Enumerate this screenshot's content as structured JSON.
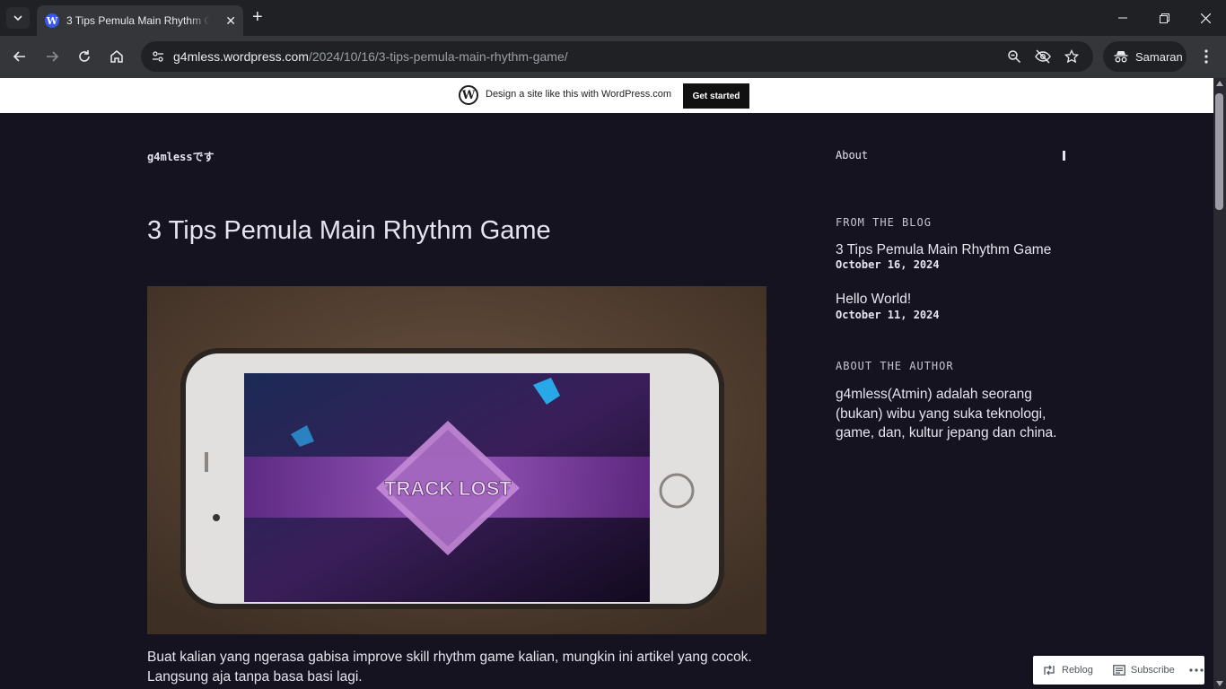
{
  "browser": {
    "tab_title": "3 Tips Pemula Main Rhythm Game",
    "url_host": "g4mless.wordpress.com",
    "url_path": "/2024/10/16/3-tips-pemula-main-rhythm-game/",
    "profile_label": "Samaran"
  },
  "wp_banner": {
    "text": "Design a site like this with WordPress.com",
    "button": "Get started"
  },
  "site": {
    "title": "g4mlessです",
    "nav_about": "About"
  },
  "post": {
    "title": "3 Tips Pemula Main Rhythm Game",
    "image_caption_text": "TRACK LOST",
    "excerpt": "Buat kalian yang ngerasa gabisa improve skill rhythm game kalian, mungkin ini artikel yang cocok. Langsung aja tanpa basa basi lagi."
  },
  "sidebar": {
    "from_blog_heading": "FROM THE BLOG",
    "posts": [
      {
        "title": "3 Tips Pemula Main Rhythm Game",
        "date": "October 16, 2024"
      },
      {
        "title": "Hello World!",
        "date": "October 11, 2024"
      }
    ],
    "about_author_heading": "ABOUT THE AUTHOR",
    "about_author_text": "g4mless(Atmin) adalah seorang (bukan) wibu yang suka teknologi, game, dan, kultur jepang dan china."
  },
  "actions": {
    "reblog": "Reblog",
    "subscribe": "Subscribe"
  },
  "colors": {
    "page_bg": "#15131f",
    "text": "#e6e4ee",
    "chrome_dark": "#202124",
    "chrome_toolbar": "#35363a"
  }
}
